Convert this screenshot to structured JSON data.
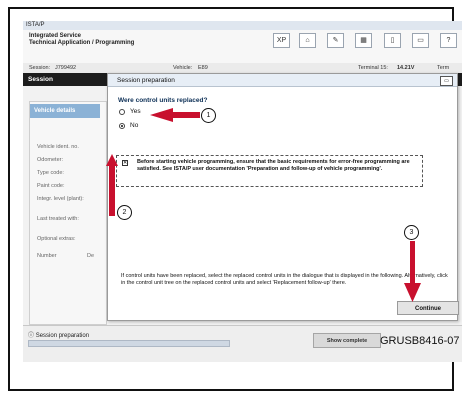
{
  "window": {
    "title": "ISTA/P"
  },
  "app": {
    "name_line1": "Integrated Service",
    "name_line2": "Technical Application / Programming"
  },
  "toolbar": {
    "xp": "XP",
    "home": "home-icon",
    "tools": "wrench-icon",
    "grid": "grid-icon",
    "doc": "document-icon",
    "print": "print-icon",
    "help": "?"
  },
  "info": {
    "session_label": "Session:",
    "session_value": "J799492",
    "vehicle_label": "Vehicle:",
    "vehicle_value": "E89",
    "terminal_label": "Terminal 15:",
    "terminal_value": "14.21V",
    "term_trunc": "Term"
  },
  "nav": {
    "session": "Session"
  },
  "left": {
    "tab": "Vehicle details",
    "fields": [
      "Vehicle ident. no.",
      "Odometer:",
      "Type code:",
      "Paint code:",
      "Integr. level (plant):",
      "Last treated with:",
      "Optional extras:",
      "Number"
    ],
    "number_value": "De"
  },
  "dialog": {
    "title": "Session preparation",
    "question": "Were control units replaced?",
    "options": [
      "Yes",
      "No"
    ],
    "selected": "No",
    "warning": "Before starting vehicle programming, ensure that the basic requirements for error-free programming are satisfied. See ISTA/P user documentation 'Preparation and follow-up of vehicle programming'.",
    "body": "If control units have been replaced, select the replaced control units in the dialogue that is displayed in the following. Alternatively, click in the control unit tree on the replaced control units and select 'Replacement follow-up' there.",
    "continue_label": "Continue"
  },
  "bottom": {
    "section": "Session preparation",
    "show_complete": "Show complete"
  },
  "callouts": [
    "1",
    "2",
    "3"
  ],
  "figure_code": "GRUSB8416-07",
  "colors": {
    "arrow": "#c8102e",
    "tab": "#8bb2d6",
    "navbar": "#1d1d1d"
  }
}
